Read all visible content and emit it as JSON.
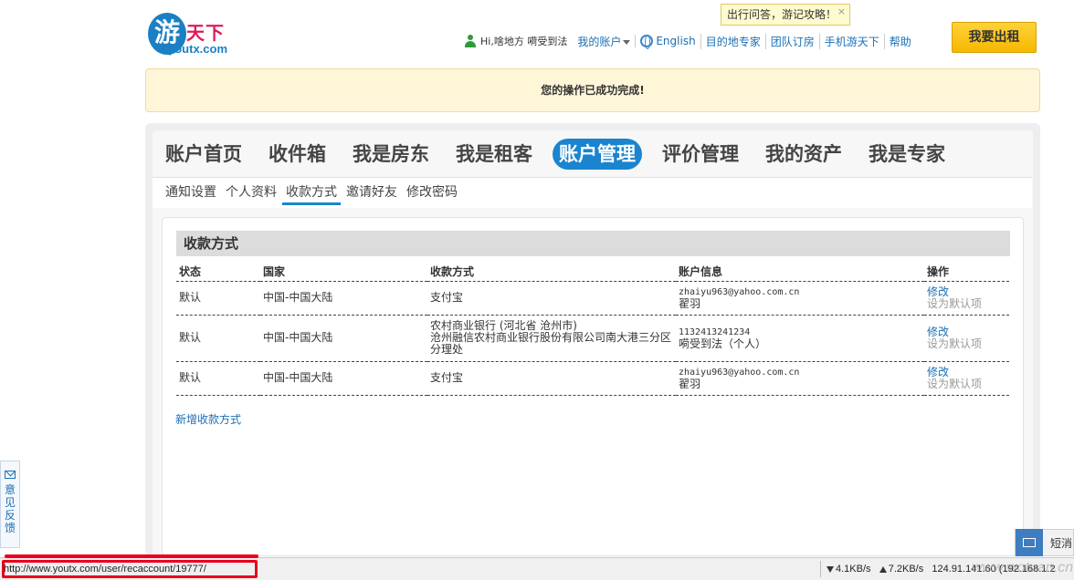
{
  "logo": {
    "glyph": "游",
    "name": "天下",
    "domain": "youtx.com"
  },
  "tooltip": {
    "text": "出行问答，游记攻略！",
    "close": "×"
  },
  "topnav": {
    "greeting": "Hi,啥地方 嗬受到法",
    "my_account": "我的账户",
    "english": "English",
    "expert": "目的地专家",
    "group": "团队订房",
    "mobile": "手机游天下",
    "help": "帮助"
  },
  "rent_button": "我要出租",
  "notice": "您的操作已成功完成!",
  "main_tabs": [
    "账户首页",
    "收件箱",
    "我是房东",
    "我是租客",
    "账户管理",
    "评价管理",
    "我的资产",
    "我是专家"
  ],
  "sub_tabs": [
    "通知设置",
    "个人资料",
    "收款方式",
    "邀请好友",
    "修改密码"
  ],
  "section_title": "收款方式",
  "table": {
    "headers": [
      "状态",
      "国家",
      "收款方式",
      "账户信息",
      "操作"
    ],
    "rows": [
      {
        "status": "默认",
        "country": "中国-中国大陆",
        "method": "支付宝",
        "method2": "",
        "account": "zhaiyu963@yahoo.com.cn",
        "account_name": "翟羽",
        "edit": "修改",
        "set_default": "设为默认项"
      },
      {
        "status": "默认",
        "country": "中国-中国大陆",
        "method": "农村商业银行 (河北省 沧州市)",
        "method2": "沧州融信农村商业银行股份有限公司南大港三分区分理处",
        "account": "1132413241234",
        "account_name": "嗬受到法（个人）",
        "edit": "修改",
        "set_default": "设为默认项"
      },
      {
        "status": "默认",
        "country": "中国-中国大陆",
        "method": "支付宝",
        "method2": "",
        "account": "zhaiyu963@yahoo.com.cn",
        "account_name": "翟羽",
        "edit": "修改",
        "set_default": "设为默认项"
      }
    ]
  },
  "add_link": "新增收款方式",
  "feedback": {
    "text": "意见反馈"
  },
  "sms": {
    "label": "短消"
  },
  "statusbar": {
    "url": "http://www.youtx.com/user/recaccount/19777/",
    "down": "4.1KB/s",
    "up": "7.2KB/s",
    "ip": "124.91.141.60 (192.168.1.2"
  },
  "watermark": "www.wotuan.cn",
  "colors": {
    "accent": "#1a84cf",
    "link": "#1a6fb5",
    "button": "#f5b800",
    "highlight": "#e8001c"
  }
}
